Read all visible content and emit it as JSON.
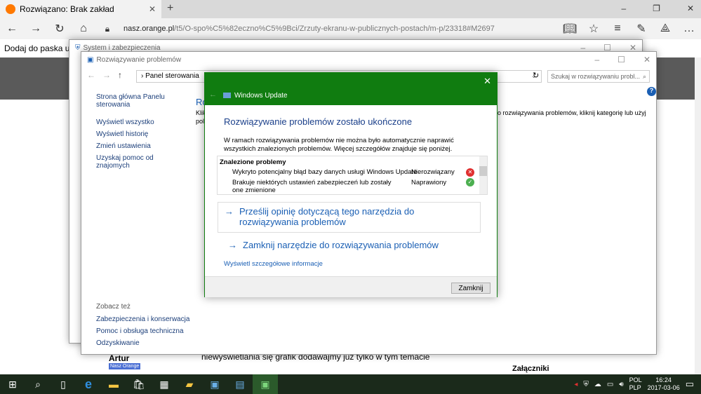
{
  "browser": {
    "tab_title": "Rozwiązano: Brak zakład",
    "url_domain": "nasz.orange.pl",
    "url_path": "/t5/O-spo%C5%82eczno%C5%9Bci/Zrzuty-ekranu-w-publicznych-postach/m-p/23318#M2697",
    "fav_bar_text": "Dodaj do paska ul"
  },
  "page": {
    "post_text": "niewyświetlania się grafik dodawajmy już tylko w tym temacie",
    "author": "Artur",
    "badge": "Nasz Orange",
    "attachments": "Załączniki"
  },
  "outer_window": {
    "title": "System i zabezpieczenia"
  },
  "cp_window": {
    "title": "Rozwiązywanie problemów",
    "breadcrumb": "Panel sterowania",
    "search_placeholder": "Szukaj w rozwiązywaniu probl...",
    "heading_partial": "Ro",
    "desc_left": "Klik",
    "desc_left2": "pol",
    "desc_right": "o rozwiązywania problemów, kliknij kategorię lub użyj",
    "sidebar": [
      "Strona główna Panelu sterowania",
      "Wyświetl wszystko",
      "Wyświetl historię",
      "Zmień ustawienia",
      "Uzyskaj pomoc od znajomych"
    ],
    "see_also_title": "Zobacz też",
    "see_also": [
      "Zabezpieczenia i konserwacja",
      "Pomoc i obsługa techniczna",
      "Odzyskiwanie"
    ]
  },
  "dialog": {
    "title": "Windows Update",
    "heading": "Rozwiązywanie problemów zostało ukończone",
    "description": "W ramach rozwiązywania problemów nie można było automatycznie naprawić wszystkich znalezionych problemów. Więcej szczegółów znajduje się poniżej.",
    "problems_header": "Znalezione problemy",
    "problems": [
      {
        "name": "Wykryto potencjalny błąd bazy danych usługi Windows Update",
        "status": "Nierozwiązany",
        "icon": "error-icon"
      },
      {
        "name": "Brakuje niektórych ustawień zabezpieczeń lub zostały one zmienione",
        "status": "Naprawiony",
        "icon": "check-icon"
      }
    ],
    "feedback_link": "Prześlij opinię dotyczącą tego narzędzia do rozwiązywania problemów",
    "close_tool_link": "Zamknij narzędzie do rozwiązywania problemów",
    "details_link": "Wyświetl szczegółowe informacje",
    "close_button": "Zamknij"
  },
  "taskbar": {
    "lang1": "POL",
    "lang2": "PLP",
    "time": "16:24",
    "date": "2017-03-06"
  },
  "colors": {
    "accent": "#107c10",
    "link": "#1a5fb4"
  }
}
